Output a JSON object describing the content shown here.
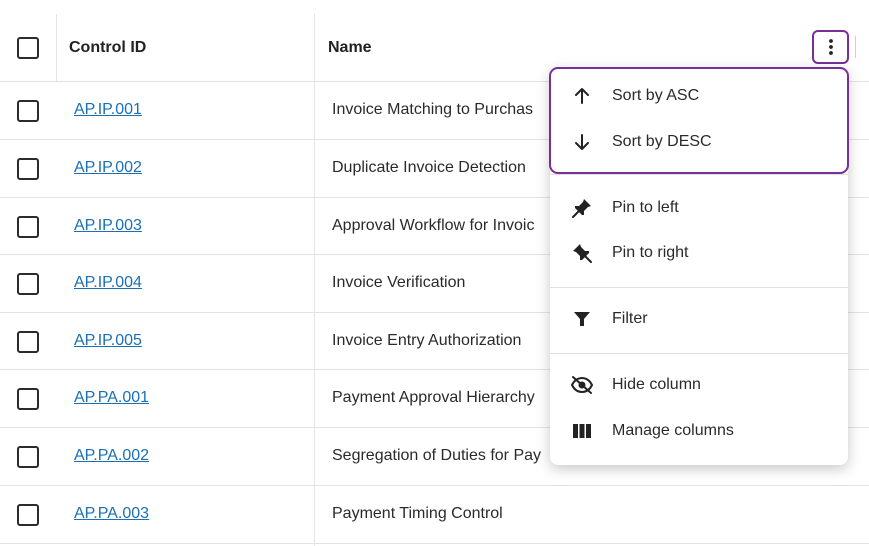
{
  "header": {
    "control_id_label": "Control ID",
    "name_label": "Name"
  },
  "rows": [
    {
      "control_id": "AP.IP.001",
      "name": "Invoice Matching to Purchas"
    },
    {
      "control_id": "AP.IP.002",
      "name": "Duplicate Invoice Detection"
    },
    {
      "control_id": "AP.IP.003",
      "name": "Approval Workflow for Invoic"
    },
    {
      "control_id": "AP.IP.004",
      "name": "Invoice Verification"
    },
    {
      "control_id": "AP.IP.005",
      "name": "Invoice Entry Authorization"
    },
    {
      "control_id": "AP.PA.001",
      "name": "Payment Approval Hierarchy"
    },
    {
      "control_id": "AP.PA.002",
      "name": "Segregation of Duties for Pay"
    },
    {
      "control_id": "AP.PA.003",
      "name": "Payment Timing Control"
    }
  ],
  "column_menu": {
    "items": [
      {
        "label": "Sort by ASC",
        "icon": "arrow-up-icon"
      },
      {
        "label": "Sort by DESC",
        "icon": "arrow-down-icon"
      },
      {
        "label": "Pin to left",
        "icon": "pin-left-icon"
      },
      {
        "label": "Pin to right",
        "icon": "pin-right-icon"
      },
      {
        "label": "Filter",
        "icon": "filter-icon"
      },
      {
        "label": "Hide column",
        "icon": "eye-off-icon"
      },
      {
        "label": "Manage columns",
        "icon": "columns-icon"
      }
    ]
  },
  "colors": {
    "accent_focus": "#7a2e9a",
    "link": "#1a6fb5"
  }
}
